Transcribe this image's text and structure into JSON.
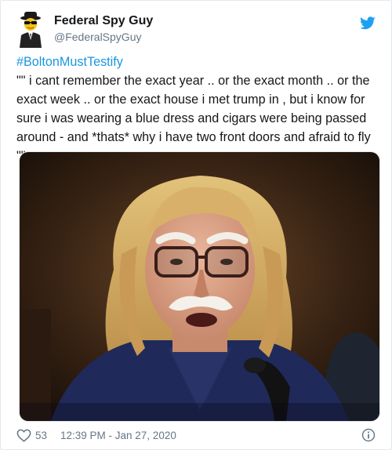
{
  "author": {
    "display_name": "Federal Spy Guy",
    "handle": "@FederalSpyGuy",
    "avatar_icon": "spy-avatar-icon"
  },
  "icons": {
    "brand": "twitter-bird-icon",
    "like": "heart-icon",
    "info": "info-icon"
  },
  "tweet": {
    "hashtag": "#BoltonMustTestify",
    "text": "\"\" i cant remember the exact year .. or the exact month .. or the exact week .. or the exact house i met trump in , but i know for sure i was wearing a blue dress and cigars were being passed around - and *thats* why i have two front doors and afraid to fly \"\""
  },
  "footer": {
    "likes": "53",
    "timestamp": "12:39 PM - Jan 27, 2020"
  },
  "colors": {
    "brand_blue": "#1da1f2",
    "link_blue": "#1b95e0",
    "text": "#14171a",
    "muted": "#657786"
  }
}
